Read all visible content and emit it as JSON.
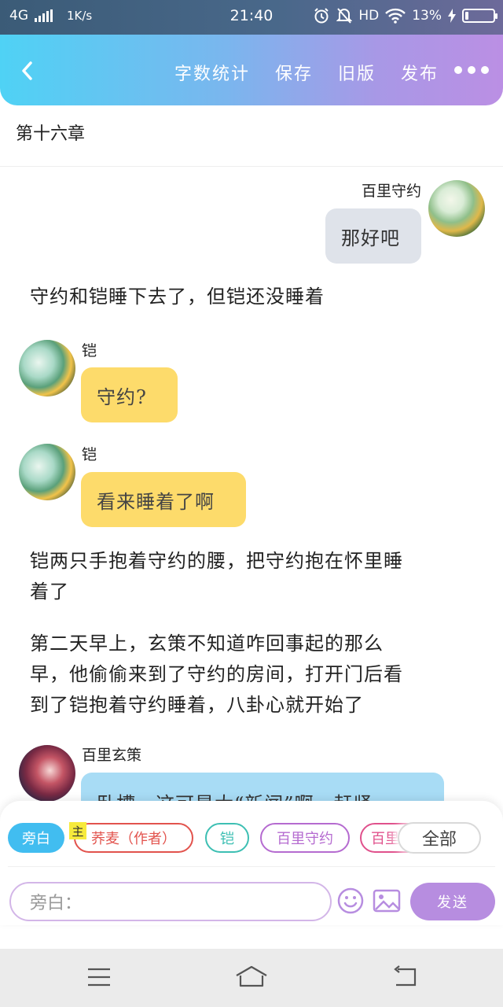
{
  "status_bar": {
    "network": "4G",
    "speed": "1K/s",
    "time": "21:40",
    "hd": "HD",
    "battery_percent": "13%",
    "battery_level": 0.13,
    "icons": [
      "signal-icon",
      "alarm-icon",
      "mute-icon",
      "wifi-icon",
      "charging-icon",
      "battery-icon"
    ]
  },
  "toolbar": {
    "back_icon": "chevron-left-icon",
    "actions": [
      "字数统计",
      "保存",
      "旧版",
      "发布"
    ],
    "more_icon": "more-dots-icon"
  },
  "chapter_title": "第十六章",
  "messages": [
    {
      "type": "bubble",
      "side": "right",
      "speaker": "百里守约",
      "text": "那好吧",
      "color": "#dfe3ea"
    },
    {
      "type": "narration",
      "text": "守约和铠睡下去了，但铠还没睡着"
    },
    {
      "type": "bubble",
      "side": "left",
      "speaker": "铠",
      "text": "守约?",
      "color": "#fddb6b"
    },
    {
      "type": "bubble",
      "side": "left",
      "speaker": "铠",
      "text": "看来睡着了啊",
      "color": "#fddb6b"
    },
    {
      "type": "narration",
      "lines": [
        "铠两只手抱着守约的腰，把守约抱在怀里睡",
        "着了"
      ]
    },
    {
      "type": "narration",
      "lines": [
        "第二天早上，玄策不知道咋回事起的那么",
        "早，他偷偷来到了守约的房间，打开门后看",
        "到了铠抱着守约睡着，八卦心就开始了"
      ]
    },
    {
      "type": "bubble",
      "side": "left",
      "speaker": "百里玄策",
      "text": "卧槽，这可是大“新闻”啊，赶紧",
      "color": "#a8dcf5"
    }
  ],
  "composer": {
    "roles": [
      {
        "label": "旁白",
        "selected": true,
        "color": "#41bdf0"
      },
      {
        "label": "荞麦（作者）",
        "color": "#e2534d"
      },
      {
        "label": "铠",
        "color": "#3dbfb3"
      },
      {
        "label": "百里守约",
        "color": "#b56bd0"
      },
      {
        "label": "百里",
        "color": "#e0518c"
      }
    ],
    "main_badge": "主",
    "all_label": "全部",
    "input_placeholder": "旁白：",
    "emoji_icon": "emoji-icon",
    "image_icon": "image-icon",
    "send_label": "发送"
  },
  "nav_bar": {
    "icons": [
      "menu-icon",
      "home-icon",
      "back-icon"
    ]
  }
}
